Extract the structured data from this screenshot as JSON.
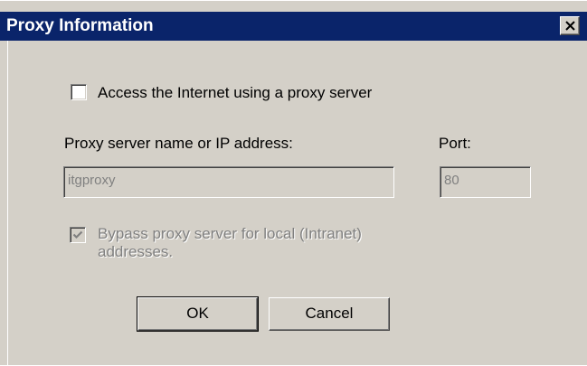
{
  "window": {
    "title": "Proxy Information"
  },
  "proxy": {
    "use_proxy_label": "Access the Internet using a proxy server",
    "use_proxy_checked": false,
    "server_label": "Proxy server name or IP address:",
    "server_value": "itgproxy",
    "port_label": "Port:",
    "port_value": "80",
    "bypass_label_line1": "Bypass proxy server for local (Intranet)",
    "bypass_label_line2": "addresses.",
    "bypass_checked": true,
    "bypass_enabled": false
  },
  "buttons": {
    "ok_label": "OK",
    "cancel_label": "Cancel"
  },
  "icons": {
    "close": "close-icon",
    "check": "checkmark-icon"
  },
  "colors": {
    "titlebar": "#0a246a",
    "face": "#d4d0c8",
    "disabled_text": "#808080"
  }
}
